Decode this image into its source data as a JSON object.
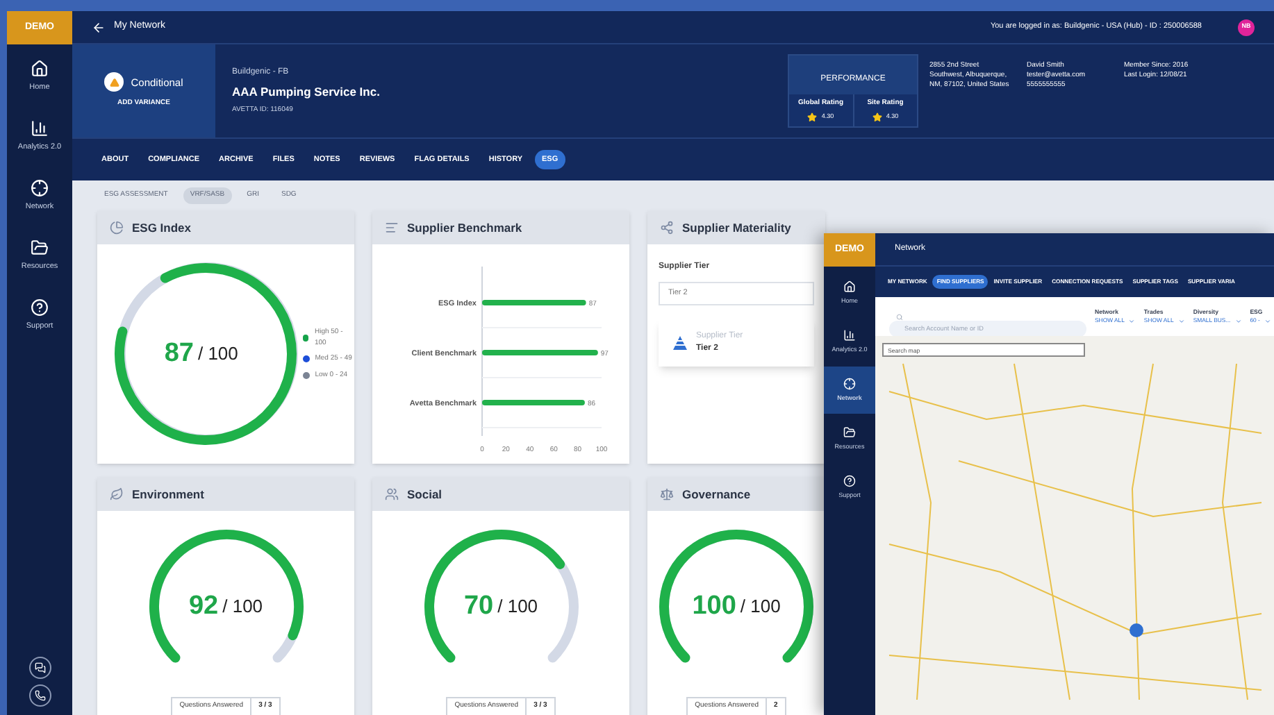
{
  "logo": "DEMO",
  "sidebar": {
    "items": [
      {
        "kind": "home",
        "label": "Home",
        "selected": false
      },
      {
        "kind": "analytics",
        "label": "Analytics 2.0",
        "selected": false
      },
      {
        "kind": "network",
        "label": "Network",
        "selected": false
      },
      {
        "kind": "resources",
        "label": "Resources",
        "selected": false
      },
      {
        "kind": "support",
        "label": "Support",
        "selected": false
      }
    ]
  },
  "topbar": {
    "title": "My Network",
    "login_info": "You are logged in as: Buildgenic - USA (Hub) - ID : 250006588",
    "avatar": "NB"
  },
  "profile": {
    "status": "Conditional",
    "action": "ADD VARIANCE",
    "parent": "Buildgenic - FB",
    "company": "AAA Pumping Service Inc.",
    "avetta_id": "AVETTA ID: 116049",
    "performance": {
      "title": "PERFORMANCE",
      "ratings": [
        {
          "label": "Global Rating",
          "value": "4.30"
        },
        {
          "label": "Site Rating",
          "value": "4.30"
        }
      ]
    },
    "address": [
      "2855 2nd Street",
      "Southwest, Albuquerque,",
      "NM, 87102, United States"
    ],
    "contact": [
      "David Smith",
      "tester@avetta.com",
      "5555555555"
    ],
    "membership": [
      "Member Since: 2016",
      "Last Login: 12/08/21"
    ]
  },
  "tabs": [
    {
      "label": "ABOUT",
      "selected": false
    },
    {
      "label": "COMPLIANCE",
      "selected": false
    },
    {
      "label": "ARCHIVE",
      "selected": false
    },
    {
      "label": "FILES",
      "selected": false
    },
    {
      "label": "NOTES",
      "selected": false
    },
    {
      "label": "REVIEWS",
      "selected": false
    },
    {
      "label": "FLAG DETAILS",
      "selected": false
    },
    {
      "label": "HISTORY",
      "selected": false
    },
    {
      "label": "ESG",
      "selected": true
    }
  ],
  "subtabs": [
    {
      "label": "ESG ASSESSMENT",
      "selected": false
    },
    {
      "label": "VRF/SASB",
      "selected": true
    },
    {
      "label": "GRI",
      "selected": false
    },
    {
      "label": "SDG",
      "selected": false
    }
  ],
  "esg_index": {
    "title": "ESG Index",
    "score": "87",
    "max": "/ 100",
    "legend": [
      {
        "label": "High 50 - 100",
        "color": "#16a34a"
      },
      {
        "label": "Med 25 - 49",
        "color": "#1d4ed8"
      },
      {
        "label": "Low 0 - 24",
        "color": "#7b8494"
      }
    ]
  },
  "benchmark": {
    "title": "Supplier Benchmark",
    "chart_data": {
      "type": "bar",
      "orientation": "horizontal",
      "categories": [
        "ESG Index",
        "Client Benchmark",
        "Avetta Benchmark"
      ],
      "series": [
        {
          "color": "#22b14c",
          "values": [
            87,
            97,
            86
          ]
        }
      ],
      "xlim": [
        0,
        100
      ],
      "xticks": [
        0,
        20,
        40,
        60,
        80,
        100
      ],
      "data_labels": true
    }
  },
  "materiality": {
    "title": "Supplier Materiality",
    "field_label": "Supplier Tier",
    "field_value": "Tier 2",
    "info_label": "Supplier Tier",
    "info_value": "Tier 2"
  },
  "pillars": [
    {
      "kind": "environment",
      "title": "Environment",
      "score": "92",
      "max": "/ 100",
      "questions_label": "Questions Answered",
      "answered": "3 / 3"
    },
    {
      "kind": "social",
      "title": "Social",
      "score": "70",
      "max": "/ 100",
      "questions_label": "Questions Answered",
      "answered": "3 / 3"
    },
    {
      "kind": "governance",
      "title": "Governance",
      "score": "100",
      "max": "/ 100",
      "questions_label": "Questions Answered",
      "answered": "2"
    }
  ],
  "overlay": {
    "logo": "DEMO",
    "title": "Network",
    "sidebar": [
      {
        "kind": "home",
        "label": "Home",
        "selected": false
      },
      {
        "kind": "analytics",
        "label": "Analytics 2.0",
        "selected": false
      },
      {
        "kind": "network",
        "label": "Network",
        "selected": true
      },
      {
        "kind": "resources",
        "label": "Resources",
        "selected": false
      },
      {
        "kind": "support",
        "label": "Support",
        "selected": false
      }
    ],
    "tabs": [
      {
        "label": "MY NETWORK",
        "selected": false
      },
      {
        "label": "FIND SUPPLIERS",
        "selected": true
      },
      {
        "label": "INVITE SUPPLIER",
        "selected": false
      },
      {
        "label": "CONNECTION REQUESTS",
        "selected": false
      },
      {
        "label": "SUPPLIER TAGS",
        "selected": false
      },
      {
        "label": "SUPPLIER VARIA",
        "selected": false
      }
    ],
    "search": {
      "placeholder": "Search Account Name or ID"
    },
    "filters": [
      {
        "label": "Network",
        "value": "SHOW ALL"
      },
      {
        "label": "Trades",
        "value": "SHOW ALL"
      },
      {
        "label": "Diversity",
        "value": "SMALL BUS..."
      },
      {
        "label": "ESG",
        "value": "60 -"
      }
    ],
    "map_search": {
      "placeholder": "Search map"
    }
  }
}
